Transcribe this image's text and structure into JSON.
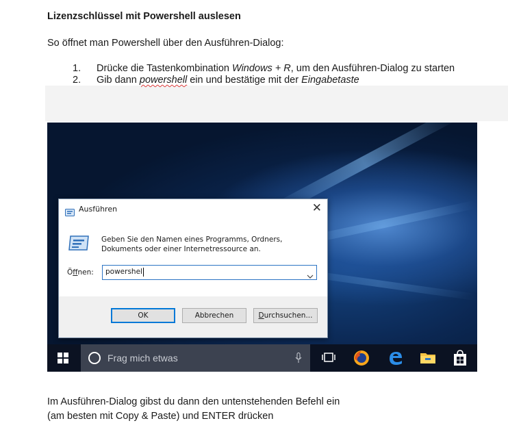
{
  "heading": "Lizenzschlüssel mit Powershell auslesen",
  "intro": "So öffnet man Powershell über den Ausführen-Dialog:",
  "steps": [
    {
      "num": "1.",
      "a": "Drücke die Tastenkombination ",
      "em": "Windows + R",
      "b": ", um den Ausführen-Dialog zu starten"
    },
    {
      "num": "2.",
      "a": "Gib dann ",
      "em": "powershell",
      "b": " ein und bestätige mit der ",
      "em2": "Eingabetaste"
    }
  ],
  "dialog": {
    "title": "Ausführen",
    "description_line1": "Geben Sie den Namen eines Programms, Ordners,",
    "description_line2": "Dokuments oder einer Internetressource an.",
    "open_label_prefix": "Ö",
    "open_label_underlined": "f",
    "open_label_suffix": "fnen:",
    "input_value": "powershell",
    "ok_label": "OK",
    "cancel_label": "Abbrechen",
    "browse_label_underlined": "D",
    "browse_label_rest": "urchsuchen..."
  },
  "taskbar": {
    "search_placeholder": "Frag mich etwas"
  },
  "outro_line1": "Im Ausführen-Dialog gibst du dann den untenstehenden Befehl ein",
  "outro_line2": "(am besten mit Copy & Paste) und ENTER drücken",
  "colors": {
    "accent": "#0078d7",
    "taskbar": "#0b1222",
    "search_box": "#3c4250",
    "spellcheck": "#e23b3b"
  }
}
